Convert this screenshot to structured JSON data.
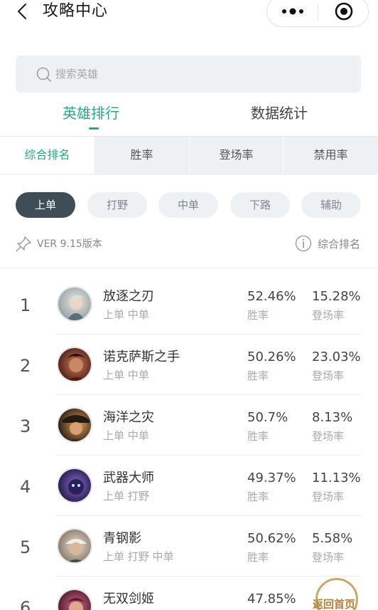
{
  "header": {
    "title": "攻略中心"
  },
  "search": {
    "placeholder": "搜索英雄"
  },
  "main_tabs": [
    {
      "label": "英雄排行",
      "active": true
    },
    {
      "label": "数据统计",
      "active": false
    }
  ],
  "sub_tabs": [
    {
      "label": "综合排名",
      "active": true
    },
    {
      "label": "胜率",
      "active": false
    },
    {
      "label": "登场率",
      "active": false
    },
    {
      "label": "禁用率",
      "active": false
    }
  ],
  "roles": [
    {
      "label": "上单",
      "active": true
    },
    {
      "label": "打野",
      "active": false
    },
    {
      "label": "中单",
      "active": false
    },
    {
      "label": "下路",
      "active": false
    },
    {
      "label": "辅助",
      "active": false
    }
  ],
  "version": {
    "text": "VER 9.15版本",
    "rank_type": "综合排名"
  },
  "labels": {
    "win": "胜率",
    "pick": "登场率"
  },
  "heroes": [
    {
      "rank": "1",
      "name": "放逐之刃",
      "roles": "上单 中单",
      "win": "52.46%",
      "pick": "15.28%"
    },
    {
      "rank": "2",
      "name": "诺克萨斯之手",
      "roles": "上单 中单",
      "win": "50.26%",
      "pick": "23.03%"
    },
    {
      "rank": "3",
      "name": "海洋之灾",
      "roles": "上单 中单",
      "win": "50.7%",
      "pick": "8.13%"
    },
    {
      "rank": "4",
      "name": "武器大师",
      "roles": "上单 打野",
      "win": "49.37%",
      "pick": "11.13%"
    },
    {
      "rank": "5",
      "name": "青钢影",
      "roles": "上单 打野 中单",
      "win": "50.62%",
      "pick": "5.58%"
    },
    {
      "rank": "6",
      "name": "无双剑姬",
      "roles": "",
      "win": "47.85%",
      "pick": ""
    }
  ],
  "home_button": {
    "label": "返回首页"
  },
  "colors": {
    "accent": "#27a884",
    "chip_active": "#3f4d57",
    "panel_bg": "#eef1f3"
  }
}
